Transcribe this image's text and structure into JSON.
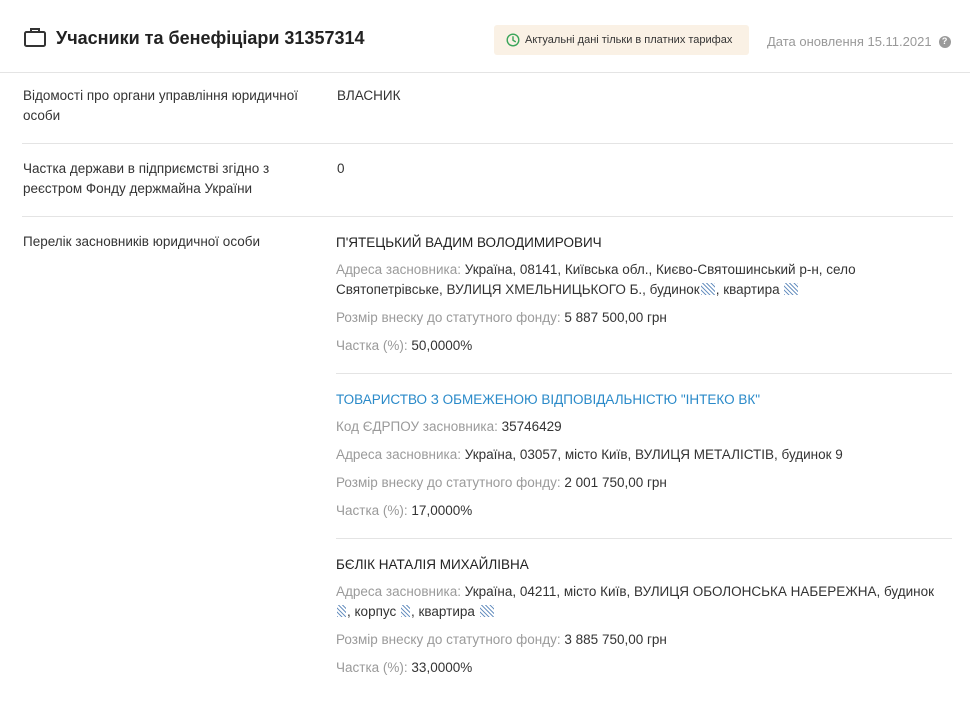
{
  "header": {
    "title": "Учасники та бенефіціари 31357314",
    "notice": "Актуальні дані тільки в платних тарифах",
    "updated": "Дата оновлення 15.11.2021",
    "help": "?"
  },
  "rows": [
    {
      "label": "Відомості про органи управління юридичної особи",
      "value": "ВЛАСНИК"
    },
    {
      "label": "Частка держави в підприємстві згідно з реєстром Фонду держмайна України",
      "value": "0"
    },
    {
      "label": "Перелік засновників юридичної особи"
    }
  ],
  "founders": [
    {
      "name": "П'ЯТЕЦЬКИЙ ВАДИМ ВОЛОДИМИРОВИЧ",
      "address_key": "Адреса засновника:",
      "address_1": "Україна, 08141, Київська обл., Києво-Святошинський р-н, село",
      "address_2a": "Святопетрівське, ВУЛИЦЯ ХМЕЛЬНИЦЬКОГО Б., будинок",
      "address_2b": ", квартира",
      "capital_key": "Розмір внеску до статутного фонду:",
      "capital": "5 887 500,00 грн",
      "share_key": "Частка (%):",
      "share": "50,0000%"
    },
    {
      "name": "ТОВАРИСТВО З ОБМЕЖЕНОЮ ВІДПОВІДАЛЬНІСТЮ \"ІНТЕКО ВК\"",
      "code_key": "Код ЄДРПОУ засновника:",
      "code": "35746429",
      "address_key": "Адреса засновника:",
      "address_1": "Україна, 03057, місто Київ, ВУЛИЦЯ МЕТАЛІСТІВ, будинок 9",
      "capital_key": "Розмір внеску до статутного фонду:",
      "capital": "2 001 750,00 грн",
      "share_key": "Частка (%):",
      "share": "17,0000%"
    },
    {
      "name": "БЄЛІК НАТАЛІЯ МИХАЙЛІВНА",
      "address_key": "Адреса засновника:",
      "address_1": "Україна, 04211, місто Київ, ВУЛИЦЯ ОБОЛОНСЬКА НАБЕРЕЖНА, будинок",
      "address_2a": ", корпус",
      "address_2b": ", квартира",
      "capital_key": "Розмір внеску до статутного фонду:",
      "capital": "3 885 750,00 грн",
      "share_key": "Частка (%):",
      "share": "33,0000%"
    }
  ]
}
